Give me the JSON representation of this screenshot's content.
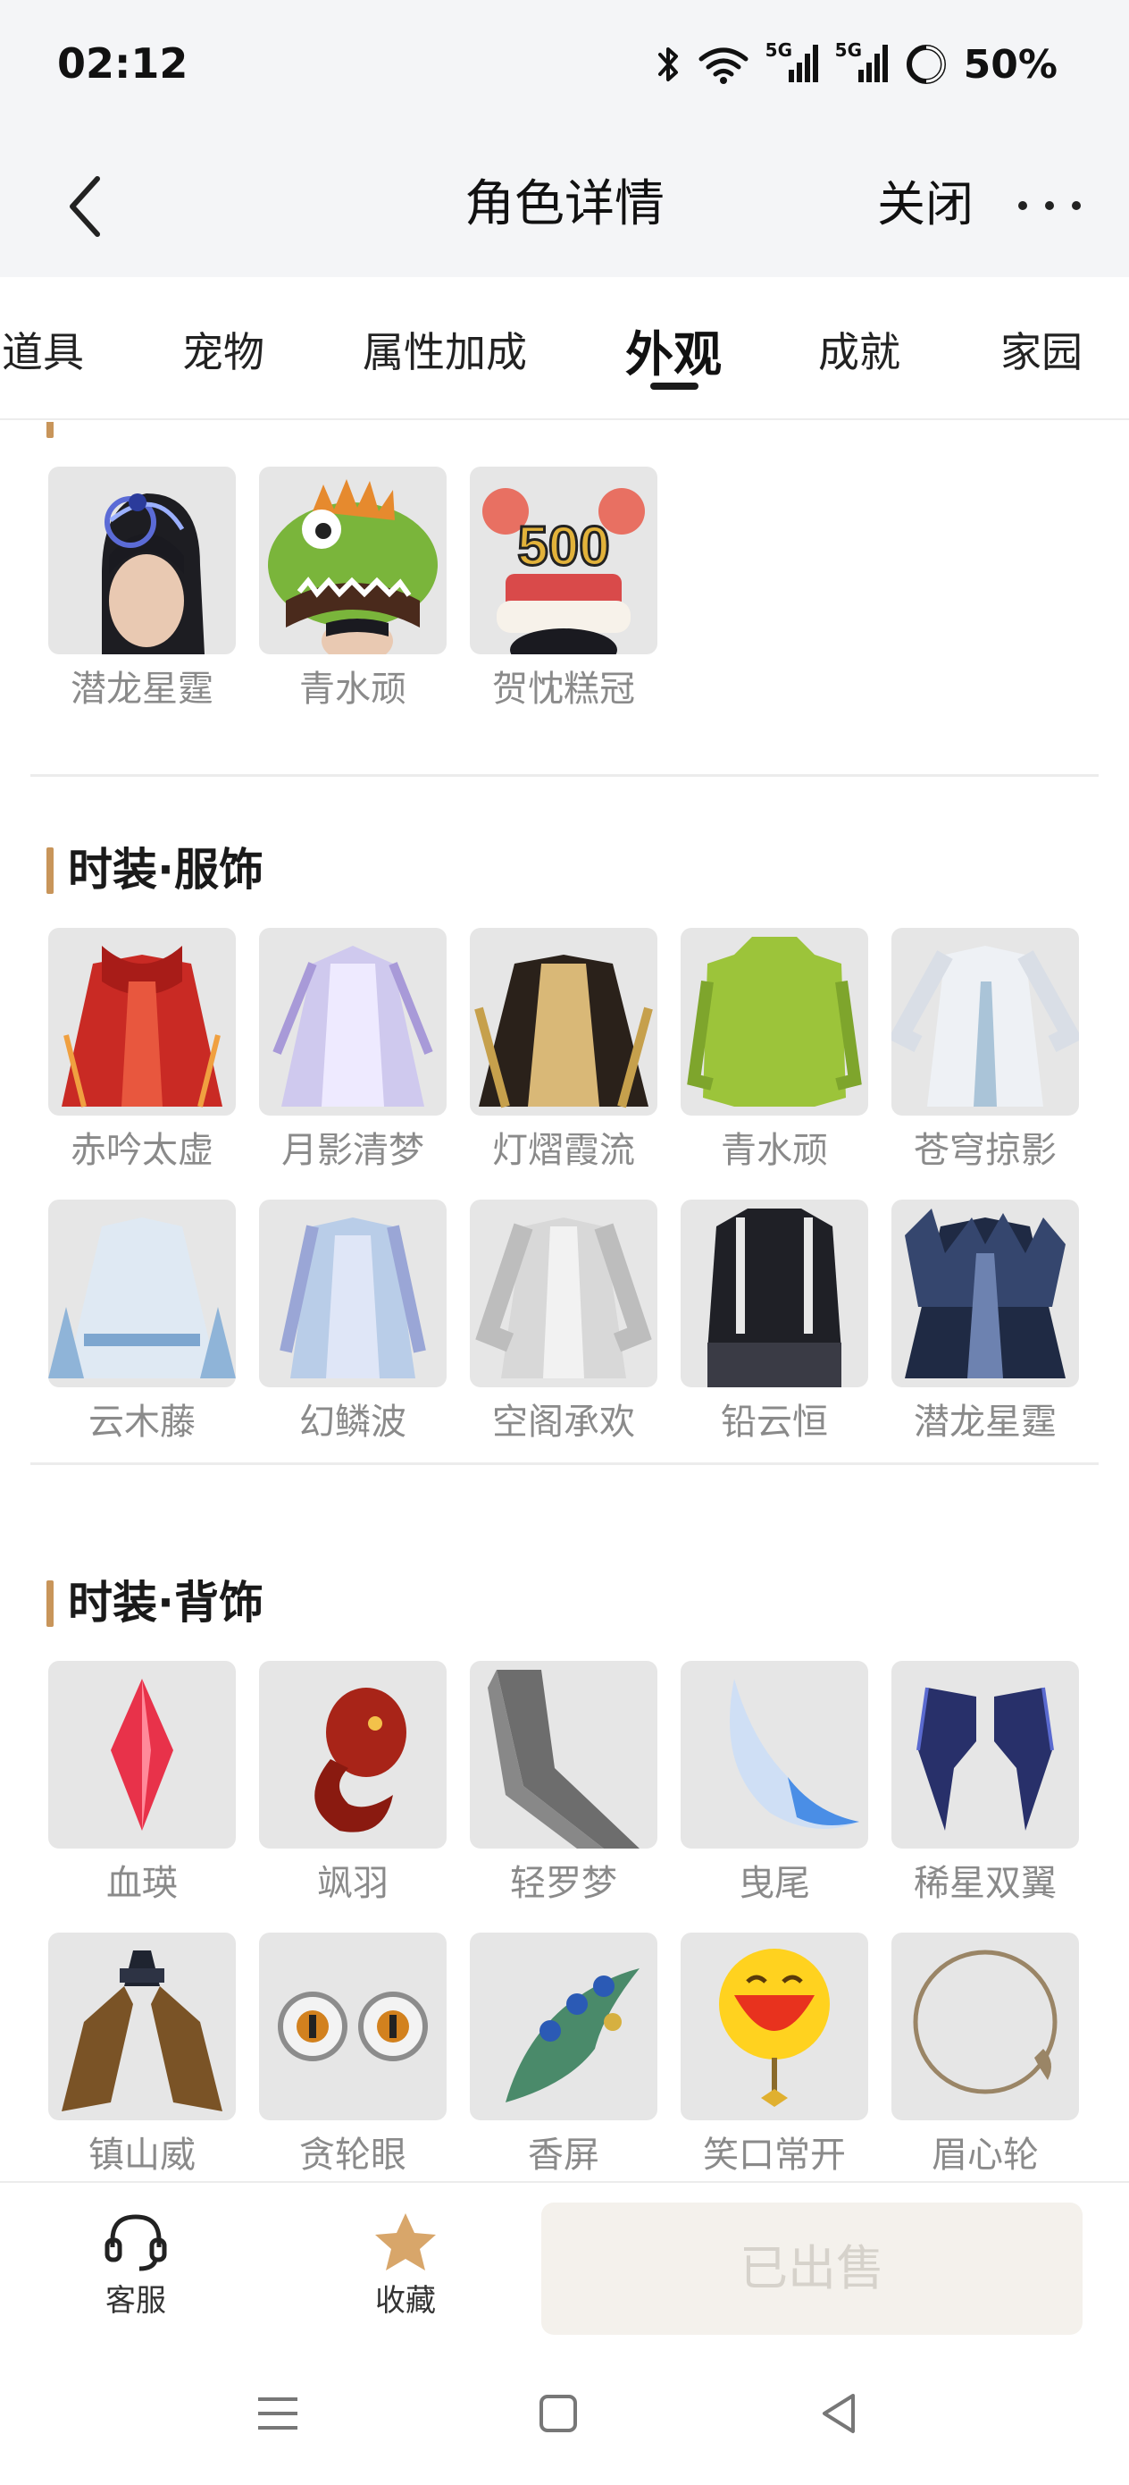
{
  "status_bar": {
    "time": "02:12",
    "network_1": "5G",
    "network_2": "5G",
    "battery": "50%",
    "icons": [
      "bluetooth-icon",
      "wifi-icon",
      "signal-icon",
      "signal-icon",
      "battery-icon"
    ]
  },
  "nav": {
    "title": "角色详情",
    "close": "关闭",
    "back_icon": "chevron-left-icon",
    "more_icon": "more-dots-icon"
  },
  "tabs": [
    {
      "label": "道具",
      "active": false
    },
    {
      "label": "宠物",
      "active": false
    },
    {
      "label": "属性加成",
      "active": false
    },
    {
      "label": "外观",
      "active": true
    },
    {
      "label": "成就",
      "active": false
    },
    {
      "label": "家园",
      "active": false
    }
  ],
  "sections": {
    "headwear": {
      "items": [
        "潜龙星霆",
        "青水顽",
        "贺忱糕冠"
      ]
    },
    "outfit": {
      "title": "时装·服饰",
      "items": [
        "赤吟太虚",
        "月影清梦",
        "灯熠霞流",
        "青水顽",
        "苍穹掠影",
        "云木藤",
        "幻鳞波",
        "空阁承欢",
        "铅云恒",
        "潜龙星霆"
      ]
    },
    "back": {
      "title": "时装·背饰",
      "items": [
        "血瑛",
        "飒羽",
        "轻罗梦",
        "曳尾",
        "稀星双翼",
        "镇山威",
        "贪轮眼",
        "香屏",
        "笑口常开",
        "眉心轮"
      ]
    }
  },
  "bottom_bar": {
    "service": "客服",
    "favorite": "收藏",
    "sold": "已出售",
    "service_icon": "headset-icon",
    "favorite_icon": "star-icon",
    "favorite_color": "#d8a66a"
  },
  "system_nav": {
    "icons": [
      "menu-icon",
      "home-square-icon",
      "back-triangle-icon"
    ]
  },
  "colors": {
    "accent": "#c8955a",
    "thumb_bg": "#e6e6e6",
    "label_gray": "#8a8a8a"
  }
}
